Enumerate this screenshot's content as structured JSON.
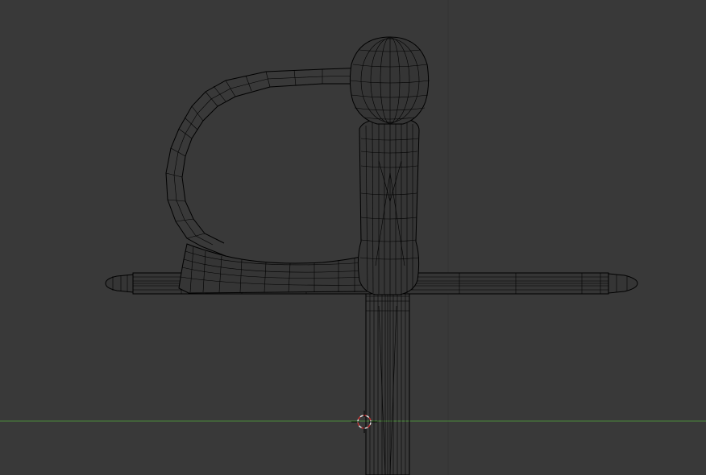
{
  "viewport": {
    "background": "#393939",
    "grid_line_color": "#333333",
    "x_axis_color": "#4a8a3a",
    "wire_color": "#000000",
    "cursor_color": "#c83232"
  },
  "scene": {
    "object": "sword-hilt",
    "view": "front-orthographic",
    "shading": "wireframe"
  },
  "cursor": {
    "icon": "3d-cursor-icon"
  }
}
